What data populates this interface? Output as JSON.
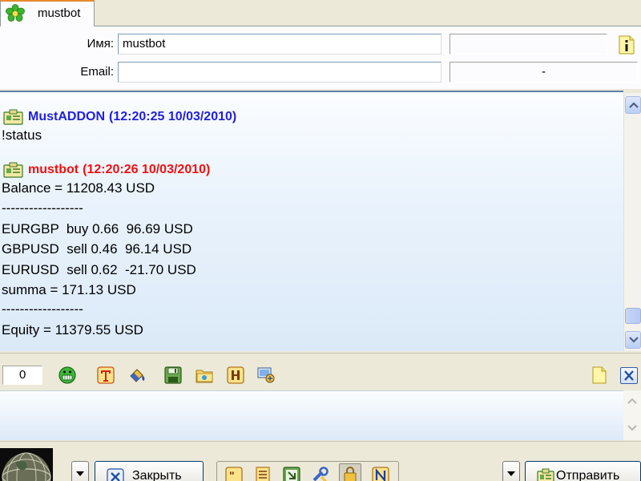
{
  "tab": {
    "title": "mustbot"
  },
  "info": {
    "name_label": "Имя:",
    "name_value": "mustbot",
    "email_label": "Email:",
    "email_value": "",
    "extra_value": "",
    "extra_email_value": "-"
  },
  "messages": [
    {
      "author": "MustADDON",
      "time": "(12:20:25 10/03/2010)",
      "color": "#2020e0",
      "lines": [
        "!status"
      ]
    },
    {
      "author": "mustbot",
      "time": "(12:20:26 10/03/2010)",
      "color": "#f01010",
      "lines": [
        "Balance = 11208.43 USD",
        "------------------",
        "EURGBP  buy 0.66  96.69 USD",
        "GBPUSD  sell 0.46  96.14 USD",
        "EURUSD  sell 0.62  -21.70 USD",
        "summa = 171.13 USD",
        "------------------",
        "Equity = 11379.55 USD"
      ]
    }
  ],
  "toolbar": {
    "counter": "0",
    "icons": [
      "smiley-icon",
      "text-format-icon",
      "paint-icon",
      "save-icon",
      "folder-icon",
      "history-icon",
      "network-icon",
      "note-icon",
      "close-icon"
    ]
  },
  "bottom": {
    "close_label": "Закрыть",
    "send_label": "Отправить"
  }
}
